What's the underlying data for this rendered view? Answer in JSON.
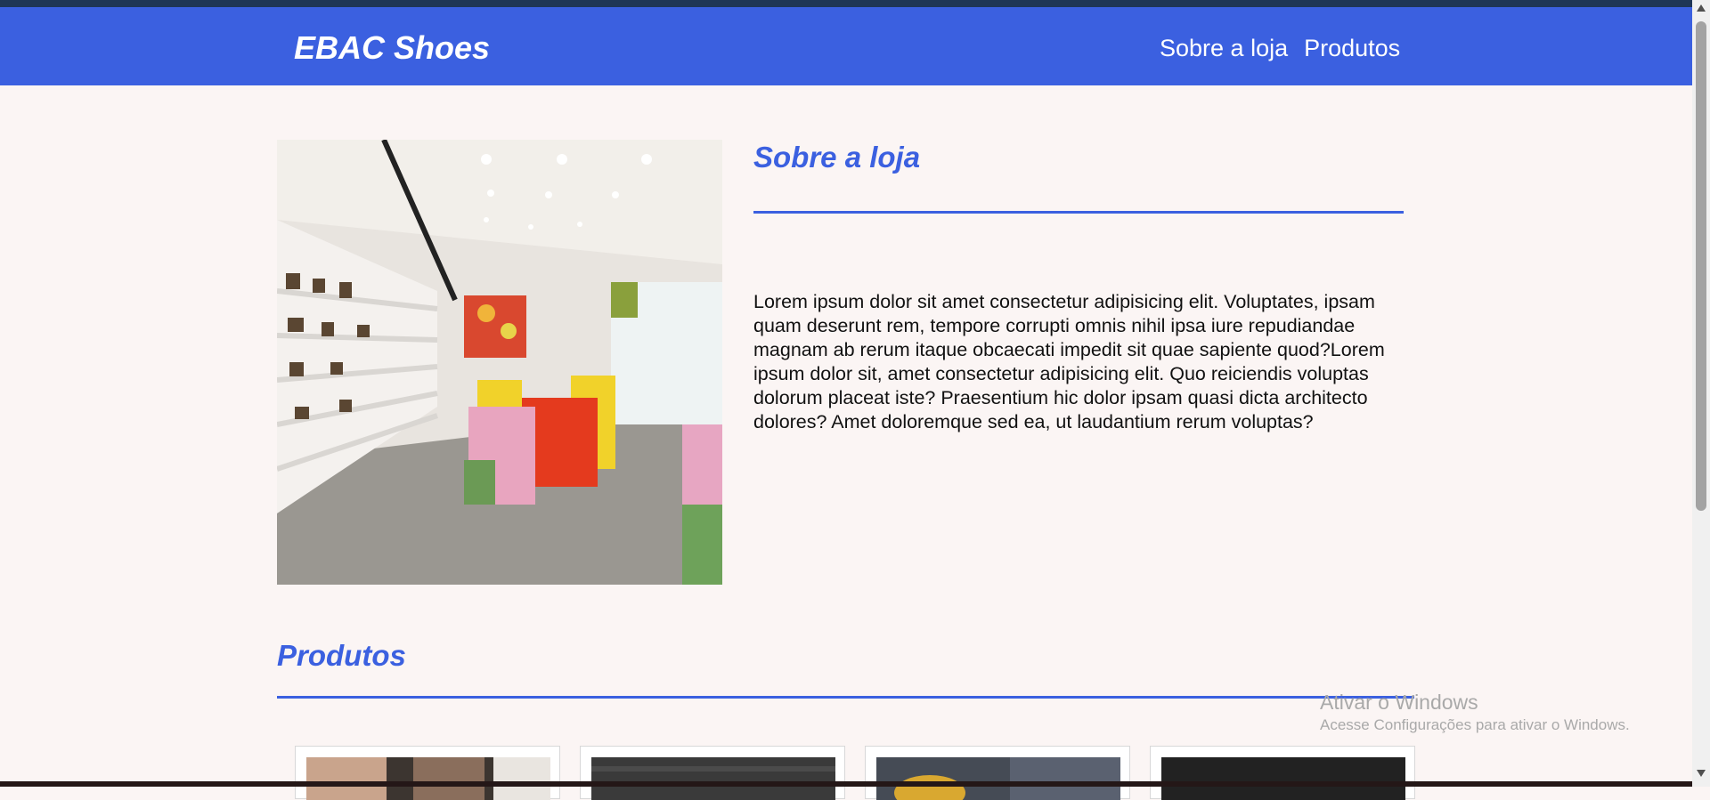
{
  "header": {
    "logo": "EBAC Shoes",
    "nav": [
      {
        "label": "Sobre a loja"
      },
      {
        "label": "Produtos"
      }
    ]
  },
  "about": {
    "title": "Sobre a loja",
    "text": "Lorem ipsum dolor sit amet consectetur adipisicing elit. Voluptates, ipsam quam deserunt rem, tempore corrupti omnis nihil ipsa iure repudiandae magnam ab rerum itaque obcaecati impedit sit quae sapiente quod?Lorem ipsum dolor sit, amet consectetur adipisicing elit. Quo reiciendis voluptas dolorum placeat iste? Praesentium hic dolor ipsam quasi dicta architecto dolores? Amet doloremque sed ea, ut laudantium rerum voluptas?"
  },
  "products": {
    "title": "Produtos"
  },
  "watermark": {
    "title": "Ativar o Windows",
    "subtitle": "Acesse Configurações para ativar o Windows."
  },
  "colors": {
    "brand_blue": "#3b60e0",
    "page_background": "#fbf5f4"
  }
}
